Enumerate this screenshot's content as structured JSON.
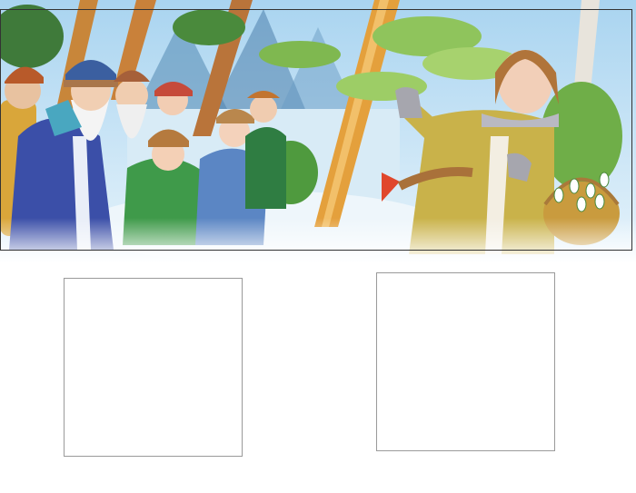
{
  "scene": {
    "figures_left": [
      "grandfather-frost",
      "elder-months",
      "child-months"
    ],
    "figure_right": "girl-with-basket",
    "basket_contents": "snowdrop-flowers"
  },
  "answer_boxes": [
    {
      "id": "left",
      "value": ""
    },
    {
      "id": "right",
      "value": ""
    }
  ],
  "colors": {
    "sky": "#bfe0f5",
    "snow": "#eef6fb",
    "coat_blue": "#3b4fa8",
    "coat_green": "#3f9a4a",
    "coat_yellow": "#c9b24a",
    "tree_trunk": "#d6903a",
    "leaves": "#9fcf6a",
    "frame": "#333333",
    "box_border": "#9a9a9a"
  }
}
